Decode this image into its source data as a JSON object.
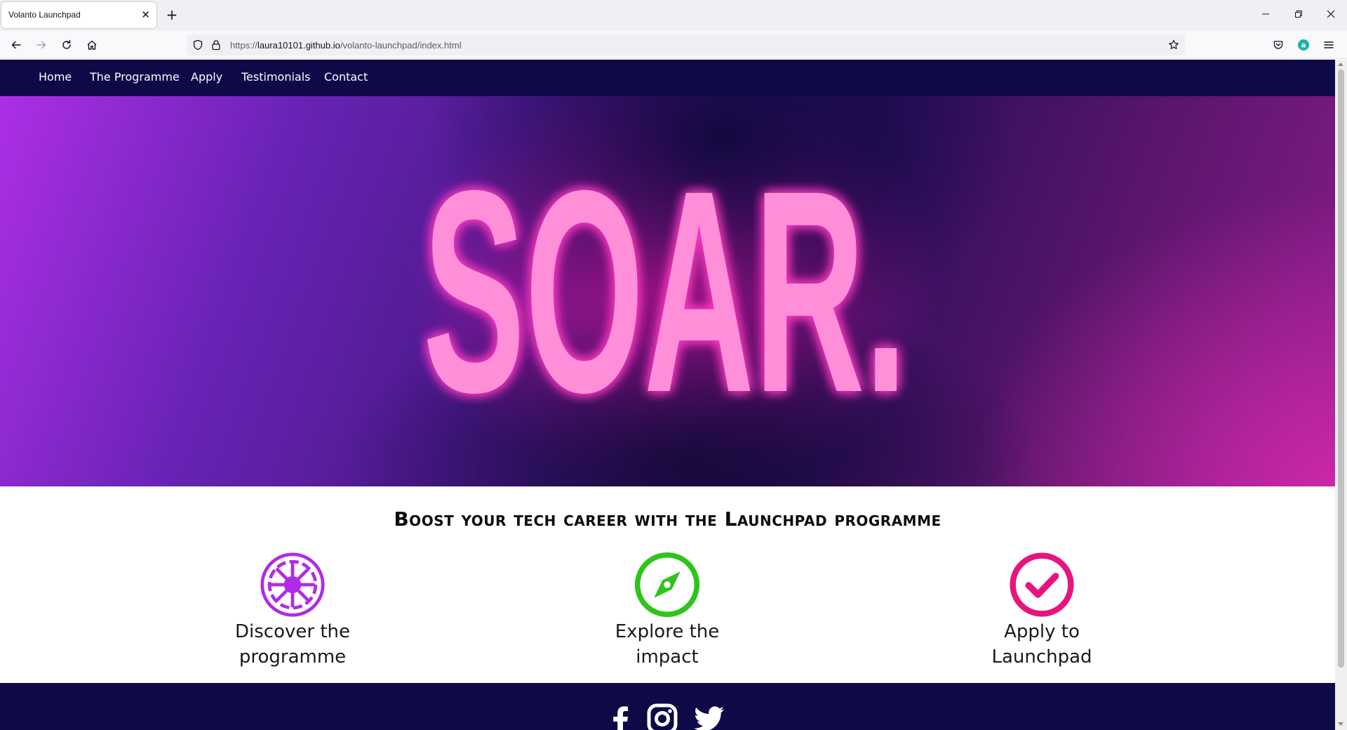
{
  "browser": {
    "tab_title": "Volanto Launchpad",
    "tab_close": "✕",
    "new_tab": "+",
    "url_scheme": "https://",
    "url_host": "laura10101.github.io",
    "url_path": "/volanto-launchpad/index.html",
    "window_controls": {
      "minimize": "–",
      "restore": "❐",
      "close": "✕"
    }
  },
  "nav": {
    "items": [
      {
        "label": "Home"
      },
      {
        "label": "The Programme"
      },
      {
        "label": "Apply"
      },
      {
        "label": "Testimonials"
      },
      {
        "label": "Contact"
      }
    ]
  },
  "hero": {
    "headline": "SOAR.",
    "text_color": "#ff8fd8",
    "glow_color": "#ff3bc4"
  },
  "intro": {
    "tagline": "Boost your tech career with the Launchpad programme",
    "features": [
      {
        "label_line1": "Discover the",
        "label_line2": "programme",
        "icon": "galactic-wheel-icon",
        "color": "#b02be8"
      },
      {
        "label_line1": "Explore the",
        "label_line2": "impact",
        "icon": "compass-icon",
        "color": "#2fc41a"
      },
      {
        "label_line1": "Apply to",
        "label_line2": "Launchpad",
        "icon": "check-circle-icon",
        "color": "#e6157d"
      }
    ]
  },
  "footer": {
    "social": [
      {
        "icon": "facebook-icon"
      },
      {
        "icon": "instagram-icon"
      },
      {
        "icon": "twitter-icon"
      }
    ]
  },
  "colors": {
    "navbar": "#0e0a48",
    "footer": "#0e0a48"
  }
}
